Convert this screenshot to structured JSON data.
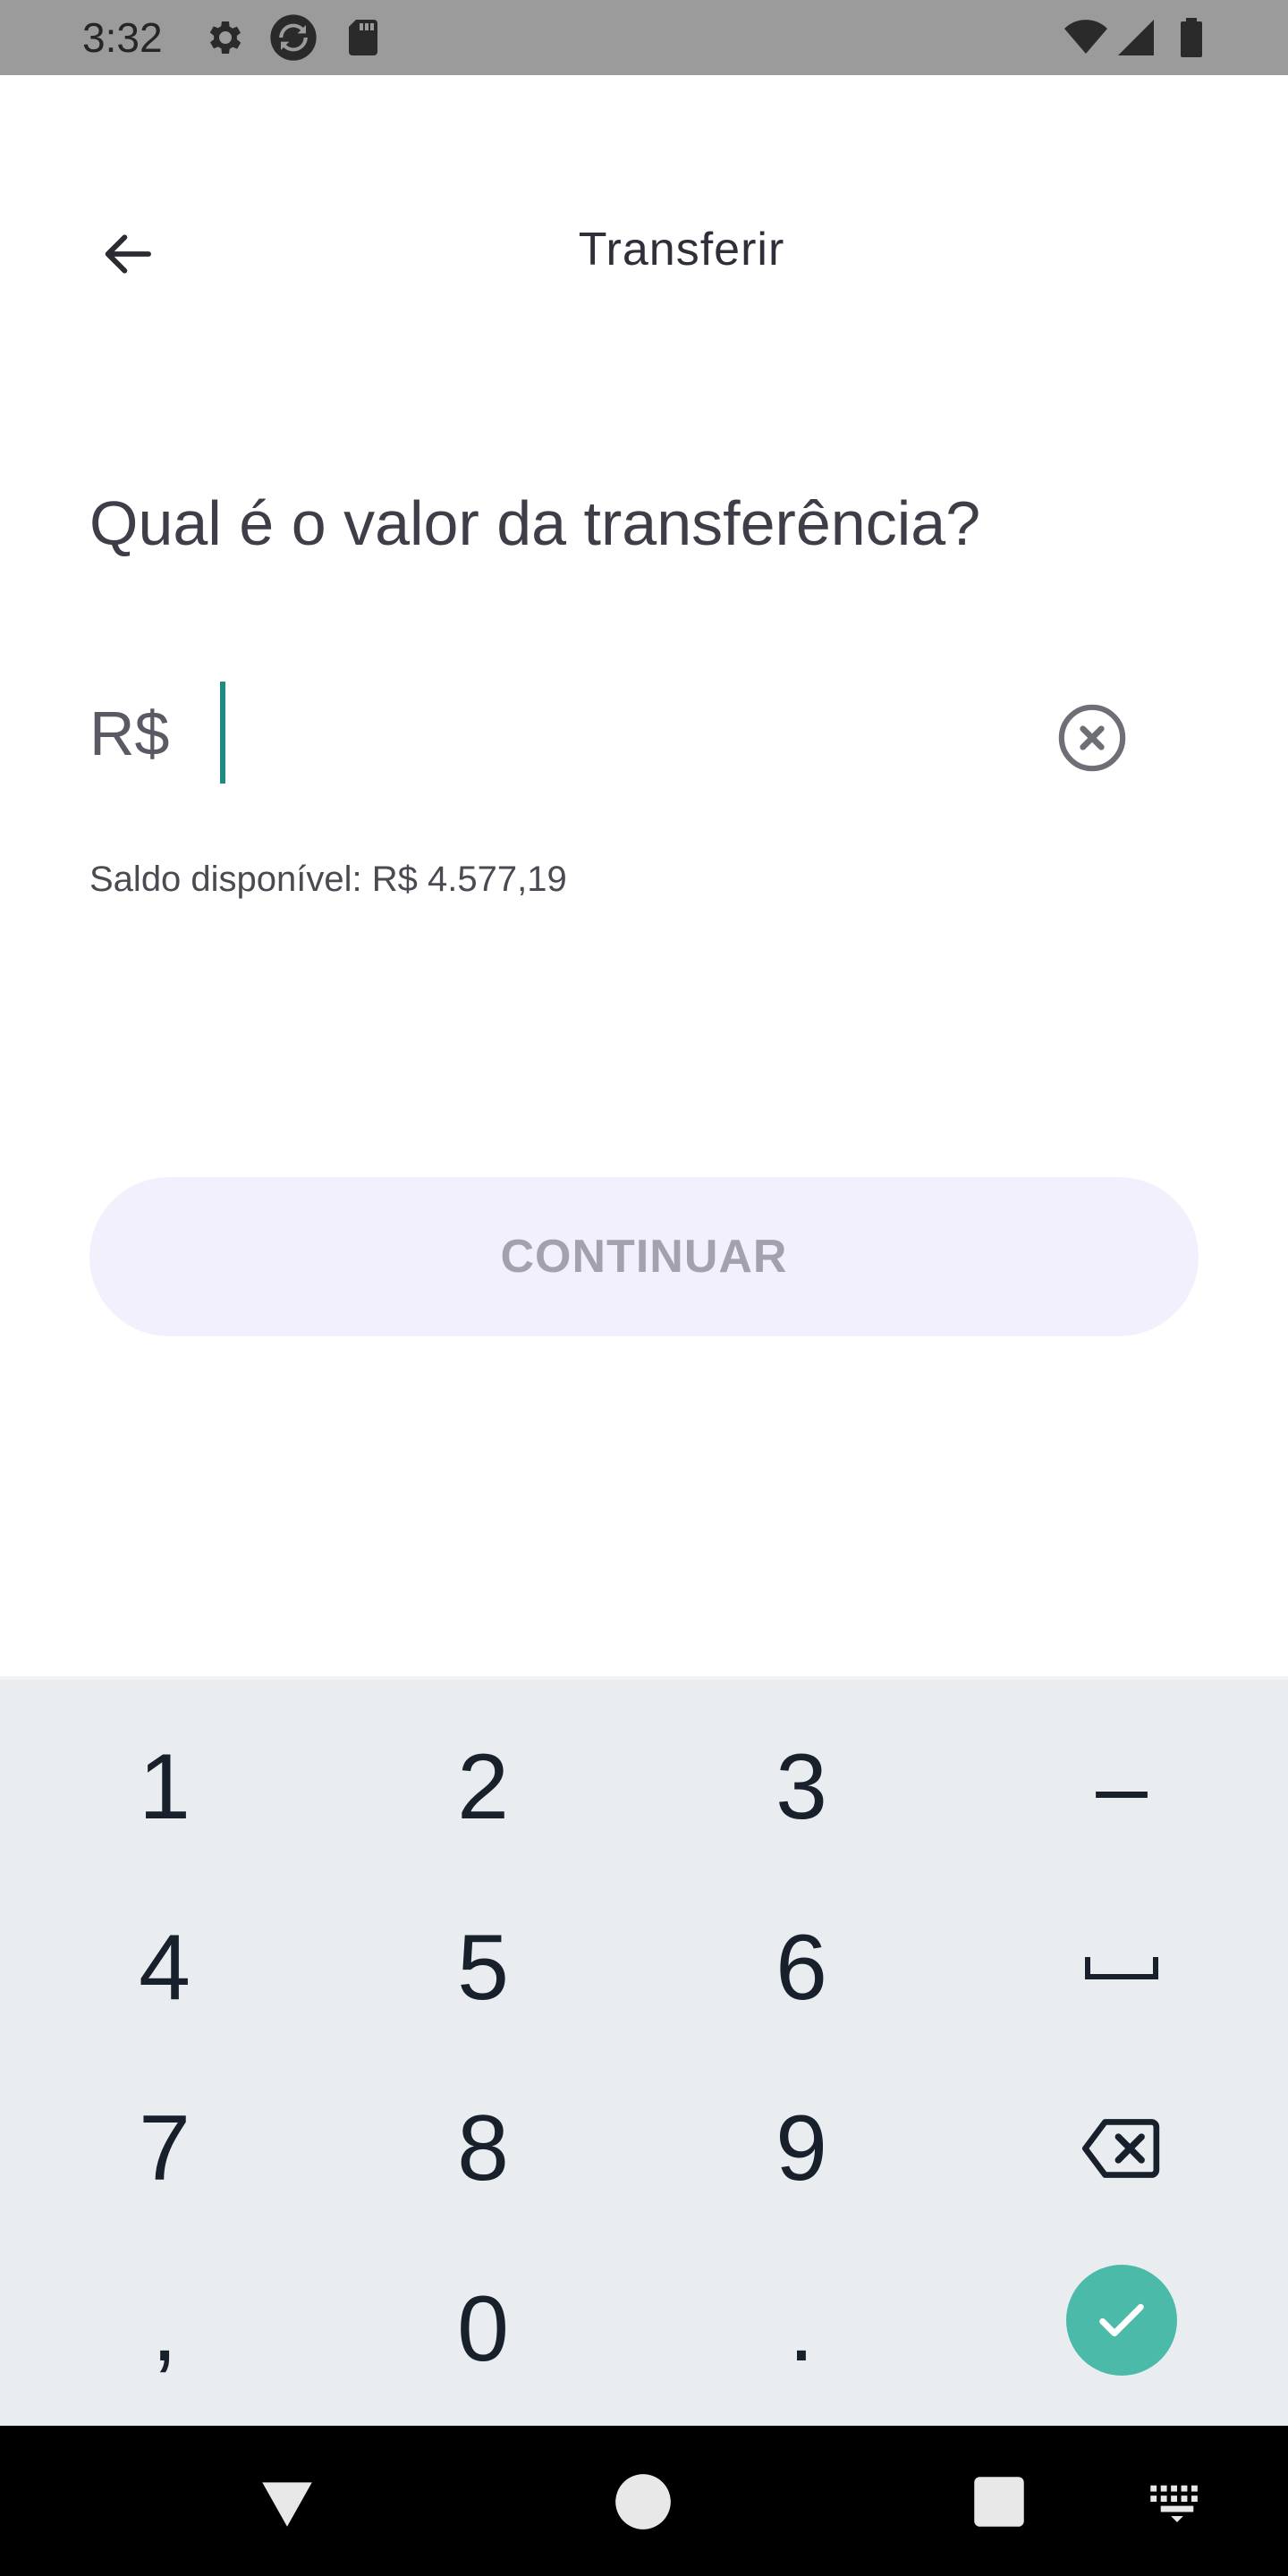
{
  "status_bar": {
    "time": "3:32",
    "left_icons": [
      "settings-icon",
      "sync-icon",
      "sd-card-icon"
    ],
    "right_icons": [
      "wifi-icon",
      "signal-icon",
      "battery-icon"
    ]
  },
  "app_bar": {
    "title": "Transferir",
    "back_icon": "arrow-left-icon"
  },
  "main": {
    "question": "Qual é o valor da transferência?",
    "currency_prefix": "R$",
    "amount_value": "",
    "clear_icon": "clear-circle-icon",
    "balance_text": "Saldo disponível: R$ 4.577,19",
    "continue_label": "CONTINUAR"
  },
  "keypad": {
    "keys": [
      {
        "row": 0,
        "col": 0,
        "label": "1"
      },
      {
        "row": 0,
        "col": 1,
        "label": "2"
      },
      {
        "row": 0,
        "col": 2,
        "label": "3"
      },
      {
        "row": 0,
        "col": 3,
        "label": "–"
      },
      {
        "row": 1,
        "col": 0,
        "label": "4"
      },
      {
        "row": 1,
        "col": 1,
        "label": "5"
      },
      {
        "row": 1,
        "col": 2,
        "label": "6"
      },
      {
        "row": 1,
        "col": 3,
        "label": "space",
        "icon": "space-icon"
      },
      {
        "row": 2,
        "col": 0,
        "label": "7"
      },
      {
        "row": 2,
        "col": 1,
        "label": "8"
      },
      {
        "row": 2,
        "col": 2,
        "label": "9"
      },
      {
        "row": 2,
        "col": 3,
        "label": "backspace",
        "icon": "backspace-icon"
      },
      {
        "row": 3,
        "col": 0,
        "label": ","
      },
      {
        "row": 3,
        "col": 1,
        "label": "0"
      },
      {
        "row": 3,
        "col": 2,
        "label": "."
      }
    ],
    "done_icon": "checkmark-icon",
    "colors": {
      "background": "#e9edf0",
      "done_button": "#4bbaa8",
      "text": "#17202b"
    }
  },
  "nav_bar": {
    "buttons": [
      "back-triangle-icon",
      "home-circle-icon",
      "recents-square-icon",
      "keyboard-icon"
    ]
  },
  "colors": {
    "accent_cursor": "#1f8a7e",
    "continue_button_bg": "#f3f0fd",
    "continue_button_text": "#a3a1ad"
  }
}
